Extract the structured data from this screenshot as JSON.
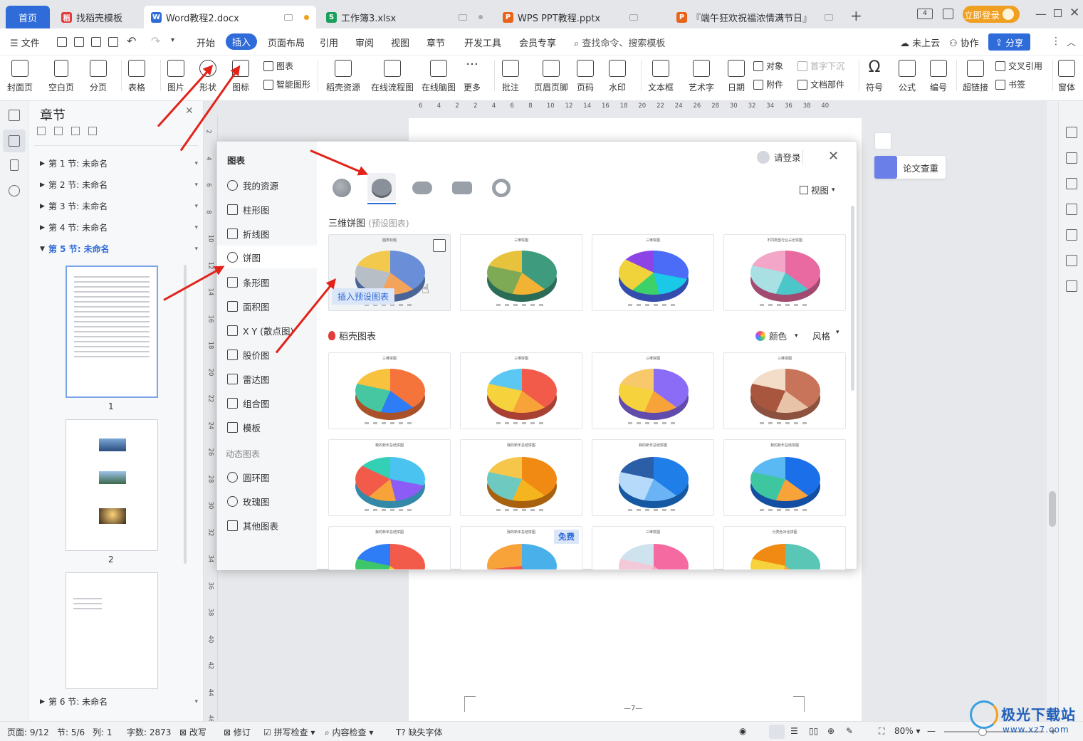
{
  "tabs": {
    "home": "首页",
    "items": [
      {
        "label": "找稻壳模板",
        "icon": "docer-icon"
      },
      {
        "label": "Word教程2.docx",
        "icon": "word-icon"
      },
      {
        "label": "工作簿3.xlsx",
        "icon": "excel-icon"
      },
      {
        "label": "WPS PPT教程.pptx",
        "icon": "ppt-icon"
      },
      {
        "label": "『端午狂欢祝福浓情满节日』",
        "icon": "ppt-icon"
      }
    ],
    "login_button": "立即登录",
    "window_count": "4"
  },
  "menu": {
    "file": "文件",
    "items": [
      "开始",
      "插入",
      "页面布局",
      "引用",
      "审阅",
      "视图",
      "章节",
      "开发工具",
      "会员专享"
    ],
    "active": "插入",
    "search_placeholder": "查找命令、搜索模板",
    "cloud": "未上云",
    "collab": "协作",
    "share": "分享"
  },
  "ribbon": {
    "cover": "封面页",
    "blank": "空白页",
    "pagebreak": "分页",
    "table": "表格",
    "picture": "图片",
    "shape": "形状",
    "icon": "图标",
    "chart": "图表",
    "smart": "智能图形",
    "docer": "稻壳资源",
    "flow": "在线流程图",
    "mind": "在线脑图",
    "more": "更多",
    "comment": "批注",
    "header": "页眉页脚",
    "pagenum": "页码",
    "watermark": "水印",
    "textbox": "文本框",
    "art": "艺术字",
    "date": "日期",
    "object": "对象",
    "attach": "附件",
    "dropcap": "首字下沉",
    "docpart": "文档部件",
    "symbol": "符号",
    "formula": "公式",
    "number": "编号",
    "hyperlink": "超链接",
    "crossref": "交叉引用",
    "bookmark": "书签",
    "window": "窗体"
  },
  "sidebar": {
    "title": "章节",
    "sections": [
      {
        "label": "第 1 节: 未命名",
        "active": false
      },
      {
        "label": "第 2 节: 未命名",
        "active": false
      },
      {
        "label": "第 3 节: 未命名",
        "active": false
      },
      {
        "label": "第 4 节: 未命名",
        "active": false
      },
      {
        "label": "第 5 节: 未命名",
        "active": true
      }
    ],
    "page_labels": [
      "1",
      "2"
    ],
    "last_section": "第 6 节: 未命名"
  },
  "ruler": {
    "top": [
      "6",
      "4",
      "2",
      "2",
      "4",
      "6",
      "8",
      "10",
      "12",
      "14",
      "16",
      "18",
      "20",
      "22",
      "24",
      "26",
      "28",
      "30",
      "32",
      "34",
      "36",
      "38",
      "40"
    ],
    "left": [
      "2",
      "4",
      "6",
      "8",
      "10",
      "12",
      "14",
      "16",
      "18",
      "20",
      "22",
      "24",
      "26",
      "28",
      "30",
      "32",
      "34",
      "36",
      "38",
      "40",
      "42",
      "44",
      "46"
    ]
  },
  "dialog": {
    "title": "图表",
    "login": "请登录",
    "categories": [
      {
        "label": "我的资源",
        "icon": "user-icon"
      },
      {
        "label": "柱形图",
        "icon": "column-chart-icon"
      },
      {
        "label": "折线图",
        "icon": "line-chart-icon"
      },
      {
        "label": "饼图",
        "icon": "pie-chart-icon",
        "selected": true
      },
      {
        "label": "条形图",
        "icon": "bar-chart-icon"
      },
      {
        "label": "面积图",
        "icon": "area-chart-icon"
      },
      {
        "label": "X Y (散点图)",
        "icon": "scatter-chart-icon"
      },
      {
        "label": "股价图",
        "icon": "stock-chart-icon"
      },
      {
        "label": "雷达图",
        "icon": "radar-chart-icon"
      },
      {
        "label": "组合图",
        "icon": "combo-chart-icon"
      },
      {
        "label": "模板",
        "icon": "template-icon"
      }
    ],
    "dynamic_heading": "动态图表",
    "dynamic": [
      {
        "label": "圆环图",
        "icon": "ring-chart-icon"
      },
      {
        "label": "玫瑰图",
        "icon": "rose-chart-icon"
      },
      {
        "label": "其他图表",
        "icon": "other-chart-icon"
      }
    ],
    "view": "视图",
    "section1_title": "三维饼图",
    "section1_sub": "(预设图表)",
    "preset_titles": [
      "图表标题",
      "三维饼图",
      "三维饼图",
      "不同类型行业占比饼图"
    ],
    "insert_preset": "插入预设图表",
    "section2_title": "稻壳图表",
    "color": "颜色",
    "style": "风格",
    "docer_titles": [
      "三维饼图",
      "三维饼图",
      "三维饼图",
      "三维饼图",
      "我的新年总结饼图",
      "我的新年总结饼图",
      "我的新年总结饼图",
      "我的新年总结饼图",
      "我的新年总结饼图",
      "我的新年总结饼图",
      "三维饼图",
      "分类色对比饼图"
    ],
    "free_badge": "免费"
  },
  "right_panel": {
    "paper_check": "论文查重"
  },
  "page_footer": "—7—",
  "status": {
    "page": "页面: 9/12",
    "section": "节: 5/6",
    "column": "列: 1",
    "words": "字数: 2873",
    "revise": "改写",
    "track": "修订",
    "spell": "拼写检查",
    "content": "内容检查",
    "font": "缺失字体",
    "zoom": "80%"
  },
  "watermark": {
    "text": "极光下载站",
    "url": "www.xz7.com"
  },
  "colors": {
    "accent": "#2f6bd9",
    "arrow": "#e2231a",
    "login": "#f0a020"
  }
}
